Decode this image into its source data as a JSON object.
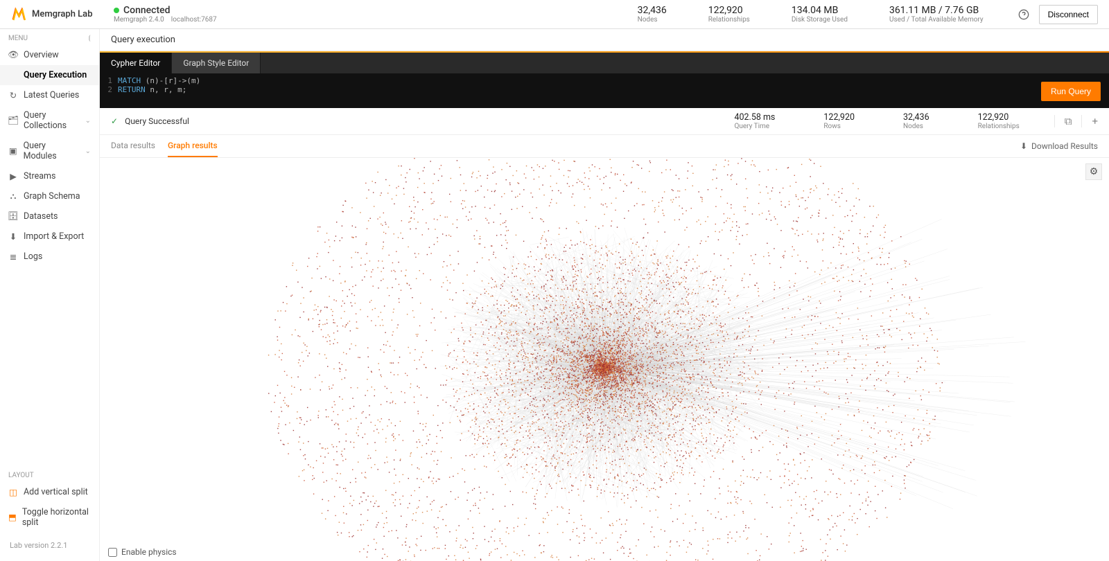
{
  "header": {
    "app_name": "Memgraph Lab",
    "status": "Connected",
    "version": "Memgraph 2.4.0",
    "host": "localhost:7687",
    "stats": {
      "nodes": {
        "value": "32,436",
        "label": "Nodes"
      },
      "relationships": {
        "value": "122,920",
        "label": "Relationships"
      },
      "disk": {
        "value": "134.04 MB",
        "label": "Disk Storage Used"
      },
      "memory": {
        "value": "361.11 MB / 7.76 GB",
        "label": "Used / Total Available Memory"
      }
    },
    "disconnect_label": "Disconnect"
  },
  "sidebar": {
    "menu_label": "MENU",
    "items": [
      {
        "label": "Overview",
        "icon": "eye"
      },
      {
        "label": "Query Execution",
        "icon": "code",
        "active": true
      },
      {
        "label": "Latest Queries",
        "icon": "history"
      },
      {
        "label": "Query Collections",
        "icon": "folder",
        "expandable": true
      },
      {
        "label": "Query Modules",
        "icon": "module",
        "expandable": true
      },
      {
        "label": "Streams",
        "icon": "play"
      },
      {
        "label": "Graph Schema",
        "icon": "schema"
      },
      {
        "label": "Datasets",
        "icon": "dataset"
      },
      {
        "label": "Import & Export",
        "icon": "download"
      },
      {
        "label": "Logs",
        "icon": "list"
      }
    ],
    "layout_label": "LAYOUT",
    "layout_items": [
      {
        "label": "Add vertical split",
        "icon": "split-v"
      },
      {
        "label": "Toggle horizontal split",
        "icon": "split-h"
      }
    ],
    "version": "Lab version 2.2.1"
  },
  "main": {
    "title": "Query execution",
    "editor_tabs": {
      "cypher": "Cypher Editor",
      "style": "Graph Style Editor"
    },
    "code": {
      "line1_kw": "MATCH",
      "line1_rest": " (n)-[r]->(m)",
      "line2_kw": "RETURN",
      "line2_rest": " n, r, m;"
    },
    "run_label": "Run Query",
    "status": {
      "text": "Query Successful",
      "metrics": {
        "time": {
          "value": "402.58 ms",
          "label": "Query Time"
        },
        "rows": {
          "value": "122,920",
          "label": "Rows"
        },
        "nodes": {
          "value": "32,436",
          "label": "Nodes"
        },
        "rels": {
          "value": "122,920",
          "label": "Relationships"
        }
      }
    },
    "result_tabs": {
      "data": "Data results",
      "graph": "Graph results"
    },
    "download_label": "Download Results",
    "physics_label": "Enable physics"
  },
  "colors": {
    "accent": "#ff7b00",
    "node1": "#c9543a",
    "node2": "#d67f3e",
    "node3": "#9a2f2f",
    "edge": "#cfcfcf"
  }
}
